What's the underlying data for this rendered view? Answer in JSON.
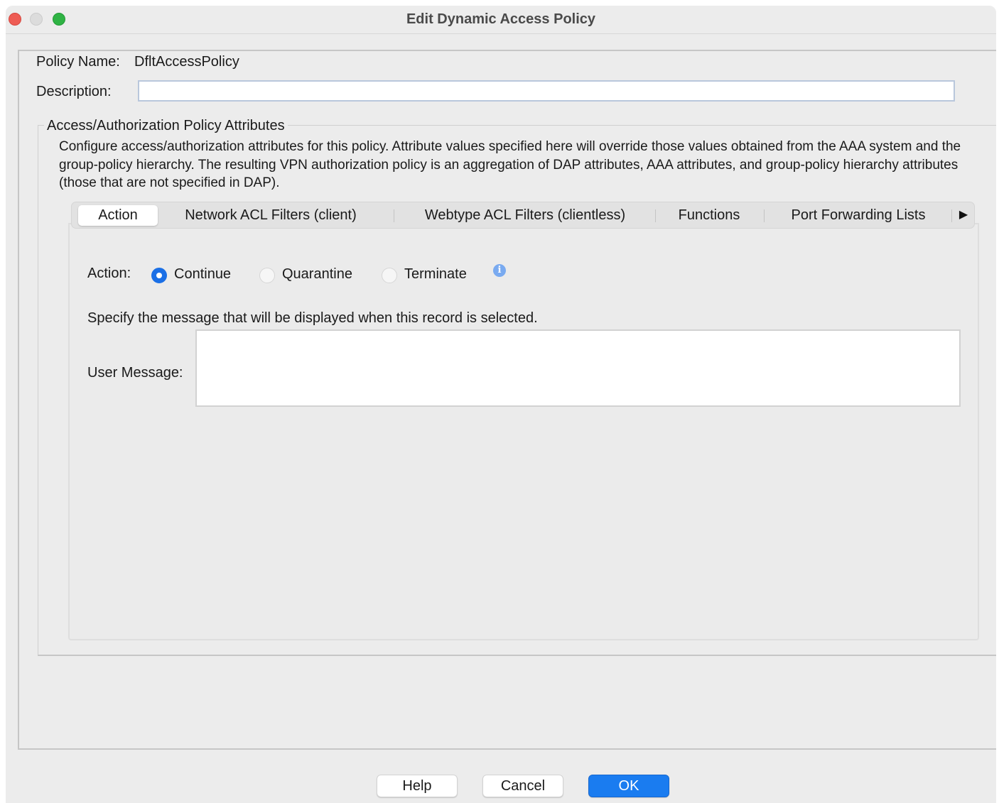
{
  "window": {
    "title": "Edit Dynamic Access Policy"
  },
  "policy": {
    "name_label": "Policy Name:",
    "name_value": "DfltAccessPolicy",
    "description_label": "Description:",
    "description_value": ""
  },
  "attributes_group": {
    "legend": "Access/Authorization Policy Attributes",
    "description": "Configure access/authorization attributes for this policy. Attribute values specified here will override those values obtained from the AAA system and the group-policy hierarchy. The resulting VPN authorization policy is an aggregation of DAP attributes, AAA attributes, and group-policy hierarchy attributes (those that are not specified in DAP)."
  },
  "tabs": [
    {
      "label": "Action",
      "active": true
    },
    {
      "label": "Network ACL Filters (client)",
      "active": false
    },
    {
      "label": "Webtype ACL Filters (clientless)",
      "active": false
    },
    {
      "label": "Functions",
      "active": false
    },
    {
      "label": "Port Forwarding Lists",
      "active": false
    }
  ],
  "tab_scroll_glyph": "▶",
  "action_tab": {
    "action_label": "Action:",
    "options": [
      {
        "label": "Continue",
        "selected": true
      },
      {
        "label": "Quarantine",
        "selected": false
      },
      {
        "label": "Terminate",
        "selected": false
      }
    ],
    "info_glyph": "i",
    "instruction": "Specify the message that will be displayed when this record is selected.",
    "user_message_label": "User Message:",
    "user_message_value": ""
  },
  "buttons": {
    "help": "Help",
    "cancel": "Cancel",
    "ok": "OK"
  },
  "colors": {
    "accent": "#1a7cf0",
    "radio_selected": "#1a6fe6",
    "window_bg": "#ececec"
  }
}
